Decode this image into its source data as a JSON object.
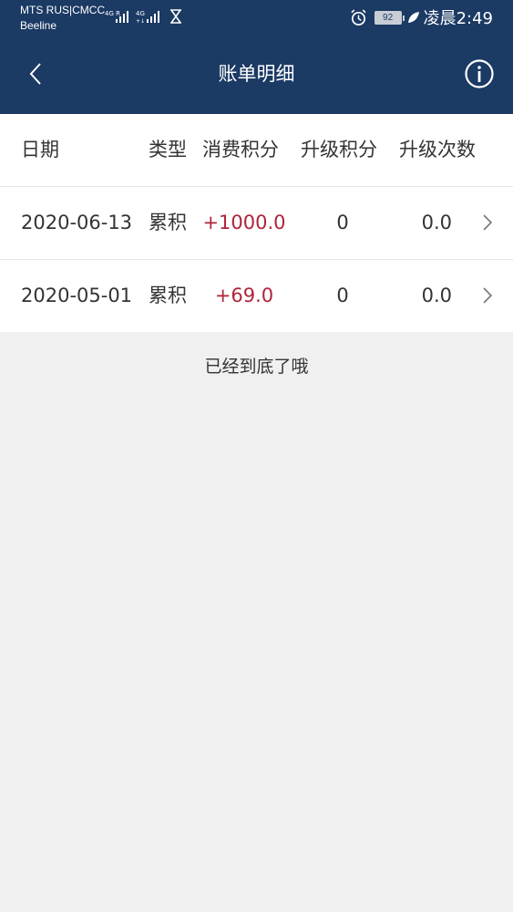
{
  "status_bar": {
    "carrier_line1": "MTS RUS|CMCC",
    "carrier_line2": "Beeline",
    "battery": "92",
    "time": "凌晨2:49"
  },
  "nav": {
    "title": "账单明细"
  },
  "table": {
    "headers": {
      "date": "日期",
      "type": "类型",
      "spend_points": "消费积分",
      "upgrade_points": "升级积分",
      "upgrade_count": "升级次数"
    },
    "rows": [
      {
        "date": "2020-06-13",
        "type": "累积",
        "spend_points": "+1000.0",
        "upgrade_points": "0",
        "upgrade_count": "0.0"
      },
      {
        "date": "2020-05-01",
        "type": "累积",
        "spend_points": "+69.0",
        "upgrade_points": "0",
        "upgrade_count": "0.0"
      }
    ]
  },
  "footer": {
    "end_note": "已经到底了哦"
  },
  "colors": {
    "header_bg": "#1b3a64",
    "positive_value": "#b0243a",
    "page_bg": "#f0f0f0"
  },
  "icons": {
    "back": "chevron-left-icon",
    "info": "info-icon",
    "row_arrow": "chevron-right-icon",
    "alarm": "alarm-clock-icon",
    "leaf": "leaf-icon",
    "signal": "signal-icon",
    "hourglass": "hourglass-icon"
  }
}
